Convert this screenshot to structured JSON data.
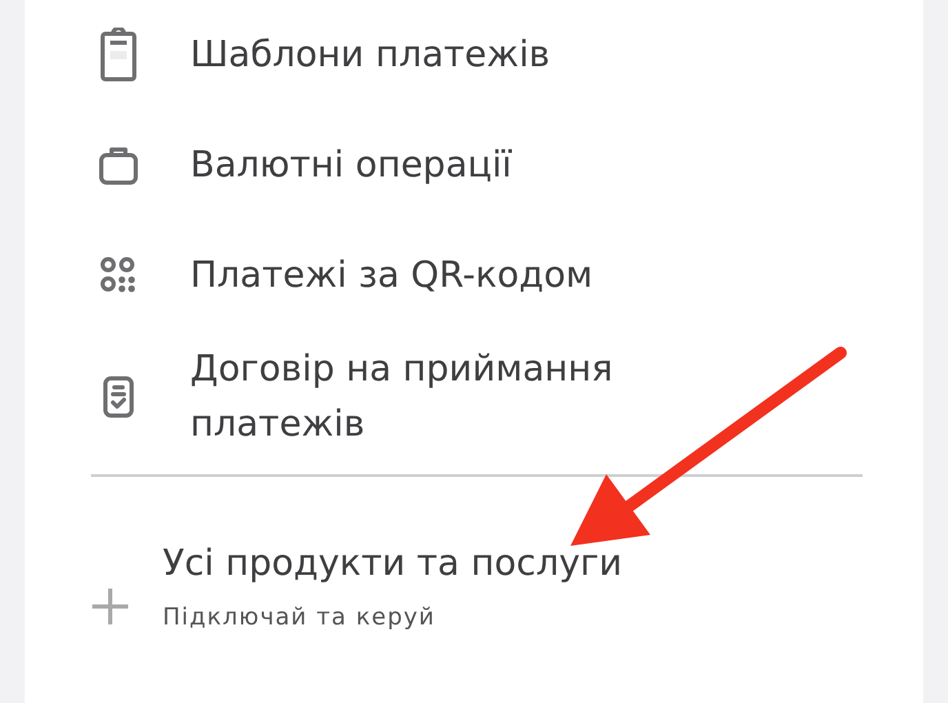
{
  "menu_items": [
    {
      "kind": "clipboard",
      "label": "Шаблони платежів"
    },
    {
      "kind": "briefcase",
      "label": "Валютні операції"
    },
    {
      "kind": "qr",
      "label": "Платежі за QR-кодом"
    },
    {
      "kind": "contract",
      "label": "Договір на приймання платежів"
    }
  ],
  "all_products": {
    "title": "Усі продукти та послуги",
    "subtitle": "Підключай та керуй"
  }
}
